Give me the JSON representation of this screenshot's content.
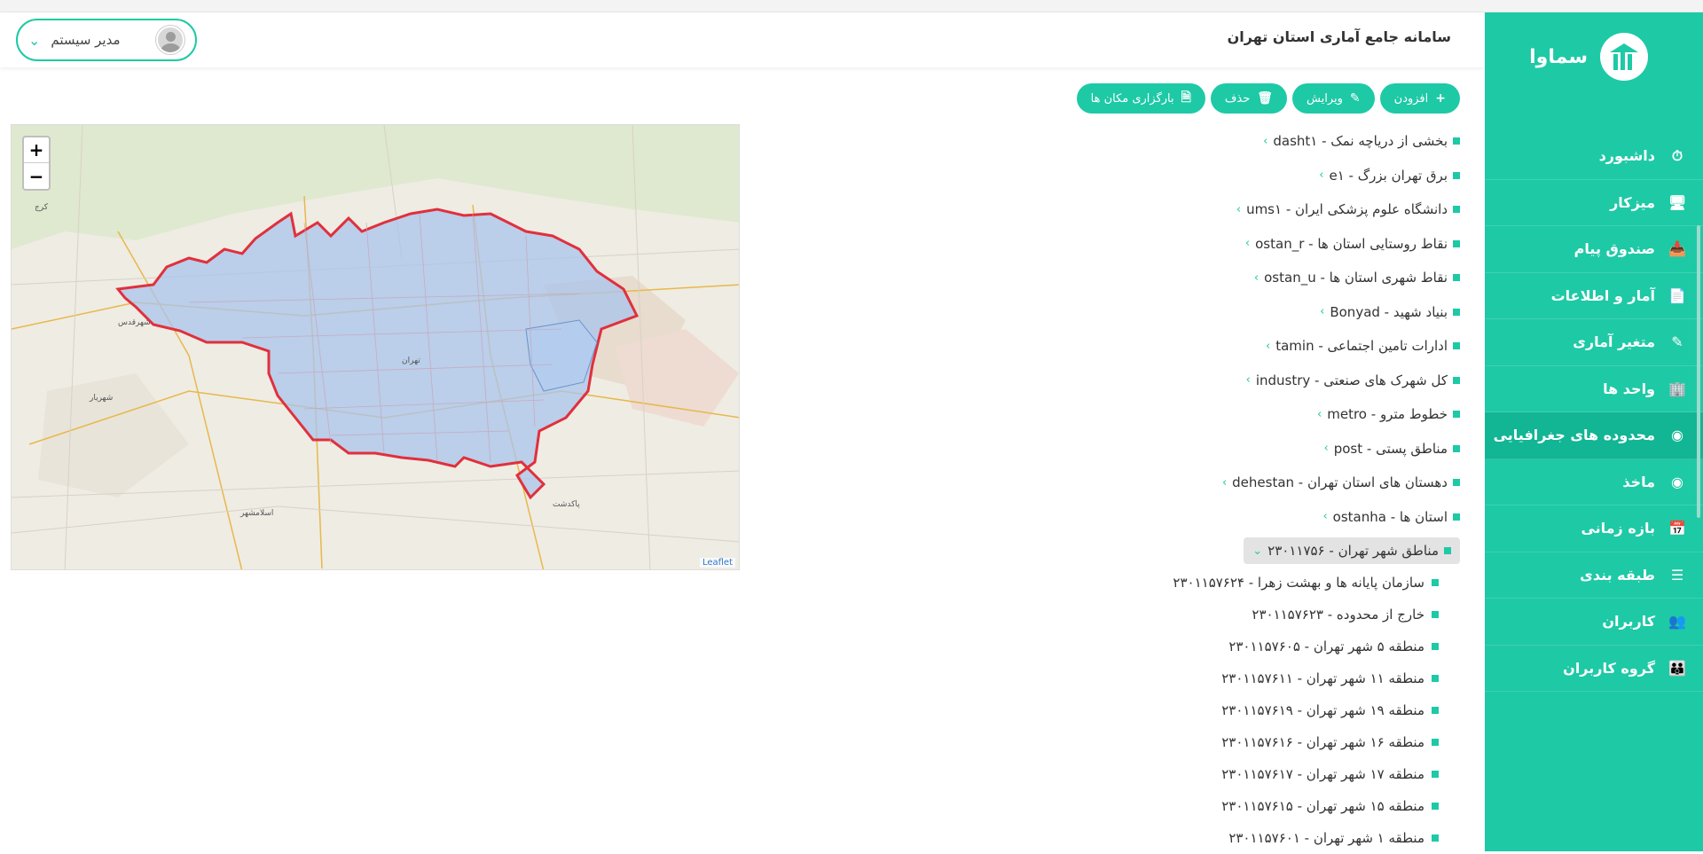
{
  "app": {
    "name": "سماوا",
    "title": "سامانه جامع آماری استان تهران"
  },
  "user": {
    "name": "مدیر سیستم"
  },
  "sidebar": {
    "items": [
      {
        "label": "داشبورد",
        "icon": "dashboard-icon"
      },
      {
        "label": "میزکار",
        "icon": "monitor-icon"
      },
      {
        "label": "صندوق پیام",
        "icon": "inbox-icon"
      },
      {
        "label": "آمار و اطلاعات",
        "icon": "document-icon"
      },
      {
        "label": "متغیر آماری",
        "icon": "pencil-icon"
      },
      {
        "label": "واحد ها",
        "icon": "building-icon"
      },
      {
        "label": "محدوده های جغرافیایی",
        "icon": "map-pin-icon",
        "active": true
      },
      {
        "label": "ماخذ",
        "icon": "map-pin-icon"
      },
      {
        "label": "بازه زمانی",
        "icon": "calendar-icon"
      },
      {
        "label": "طبقه بندی",
        "icon": "layers-icon"
      },
      {
        "label": "کاربران",
        "icon": "users-icon"
      },
      {
        "label": "گروه کاربران",
        "icon": "user-group-icon"
      }
    ]
  },
  "toolbar": {
    "add": "افزودن",
    "edit": "ویرایش",
    "delete": "حذف",
    "upload": "بارگزاری مکان ها"
  },
  "tree": [
    "dasht۱ - بخشی از دریاچه نمک",
    "e۱ - برق تهران بزرگ",
    "ums۱ - دانشگاه علوم پزشکی ایران",
    "ostan_r - نقاط روستایی استان ها",
    "ostan_u - نقاط شهری استان ها",
    "Bonyad - بنیاد شهید",
    "tamin - ادارات تامین اجتماعی",
    "industry - کل شهرک های صنعتی",
    "metro - خطوط مترو",
    "post - مناطق پستی",
    "dehestan - دهستان های استان تهران",
    "ostanha - استان ها",
    "۲۳۰۱۱۷۵۶ - مناطق شهر تهران"
  ],
  "subtree": [
    "۲۳۰۱۱۵۷۶۲۴ - سازمان پایانه ها و بهشت زهرا",
    "۲۳۰۱۱۵۷۶۲۳ - خارج از محدوده",
    "۲۳۰۱۱۵۷۶۰۵ - منطقه ۵ شهر تهران",
    "۲۳۰۱۱۵۷۶۱۱ - منطقه ۱۱ شهر تهران",
    "۲۳۰۱۱۵۷۶۱۹ - منطقه ۱۹ شهر تهران",
    "۲۳۰۱۱۵۷۶۱۶ - منطقه ۱۶ شهر تهران",
    "۲۳۰۱۱۵۷۶۱۷ - منطقه ۱۷ شهر تهران",
    "۲۳۰۱۱۵۷۶۱۵ - منطقه ۱۵ شهر تهران",
    "۲۳۰۱۱۵۷۶۰۱ - منطقه ۱ شهر تهران"
  ],
  "map": {
    "zoom_in": "+",
    "zoom_out": "−",
    "attribution": "Leaflet",
    "labels": [
      "کرج",
      "شهریار",
      "تهران",
      "شهرقدس",
      "اسلامشهر",
      "پاکدشت"
    ]
  }
}
